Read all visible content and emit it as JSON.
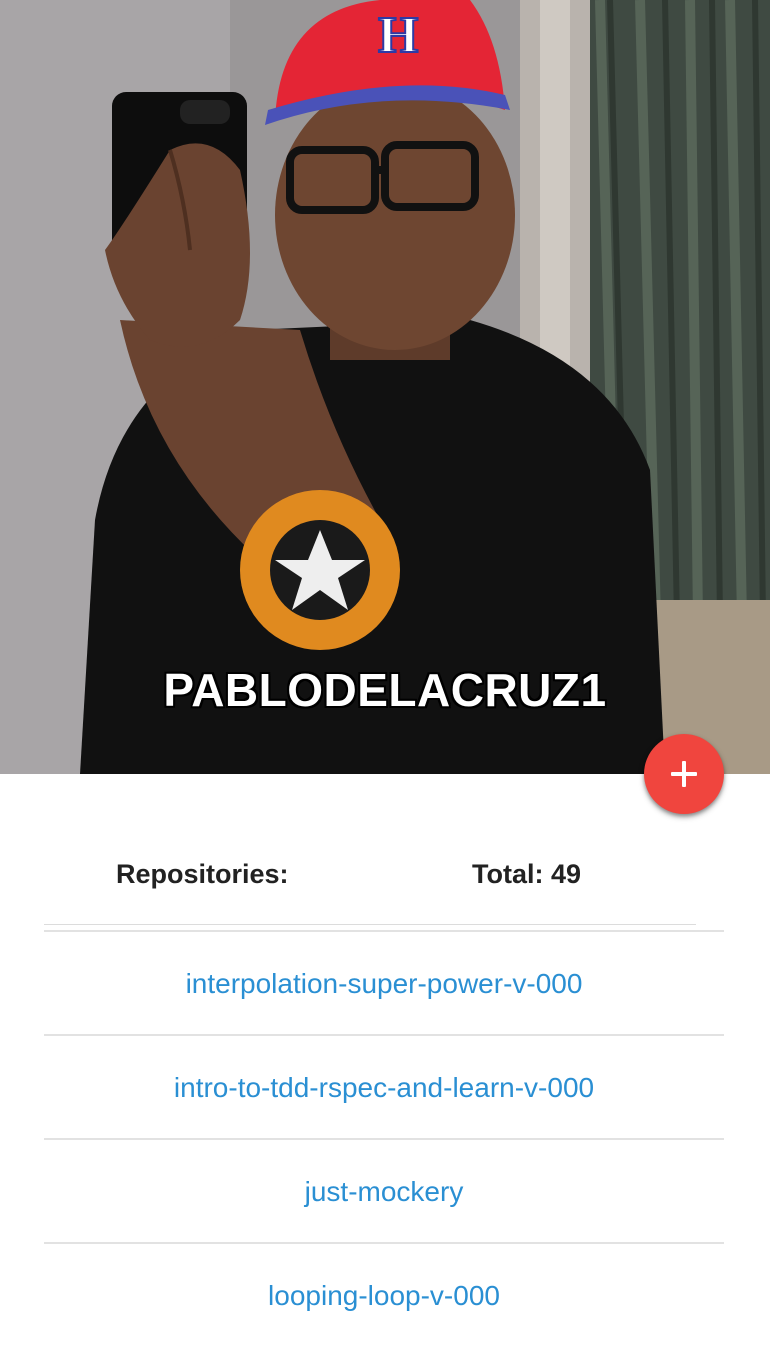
{
  "profile": {
    "username": "PABLODELACRUZ1",
    "photo_subject": "mirror selfie of user in red cap and black t-shirt"
  },
  "actions": {
    "add_icon": "plus-icon",
    "add_color": "#f0453e"
  },
  "repositories": {
    "label": "Repositories:",
    "total": "Total: 49",
    "items": [
      {
        "name": "interpolation-super-power-v-000"
      },
      {
        "name": "intro-to-tdd-rspec-and-learn-v-000"
      },
      {
        "name": "just-mockery"
      },
      {
        "name": "looping-loop-v-000"
      }
    ]
  },
  "colors": {
    "link": "#2a8fd3",
    "text": "#222222",
    "divider": "#e2e2e2"
  }
}
